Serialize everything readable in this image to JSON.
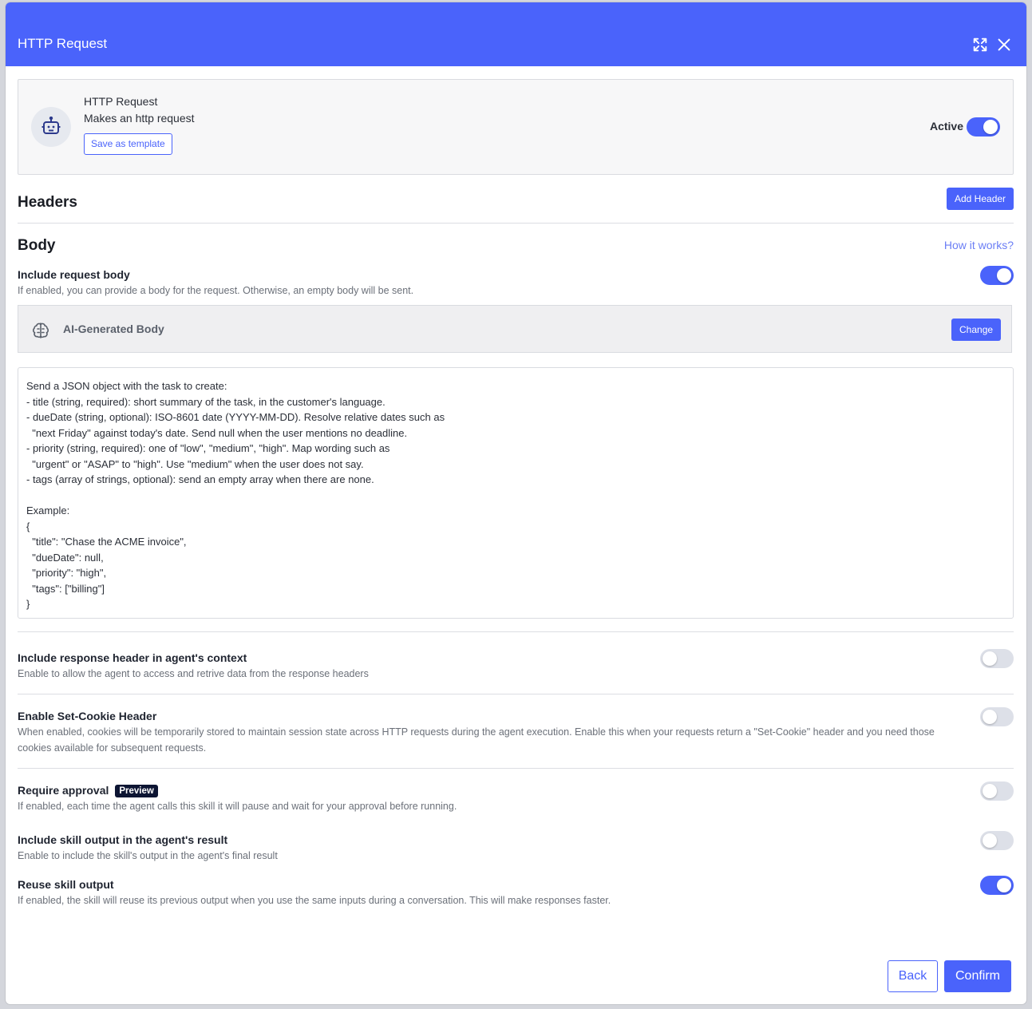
{
  "modal": {
    "title": "HTTP Request",
    "icons": {
      "expand": "expand-icon",
      "close": "close-icon"
    }
  },
  "skill": {
    "name": "HTTP Request",
    "description": "Makes an http request",
    "save_template_label": "Save as template",
    "active_label": "Active",
    "active": true,
    "icon": "robot-icon"
  },
  "headers": {
    "title": "Headers",
    "add_button": "Add Header"
  },
  "body": {
    "title": "Body",
    "how_it_works": "How it works?",
    "include_body": {
      "title": "Include request body",
      "description": "If enabled, you can provide a body for the request. Otherwise, an empty body will be sent.",
      "enabled": true
    },
    "ai_body": {
      "label": "AI-Generated Body",
      "change_button": "Change",
      "icon": "brain-icon"
    },
    "prompt": "Send a JSON object with the task to create:\n- title (string, required): short summary of the task, in the customer's language.\n- dueDate (string, optional): ISO-8601 date (YYYY-MM-DD). Resolve relative dates such as\n  \"next Friday\" against today's date. Send null when the user mentions no deadline.\n- priority (string, required): one of \"low\", \"medium\", \"high\". Map wording such as\n  \"urgent\" or \"ASAP\" to \"high\". Use \"medium\" when the user does not say.\n- tags (array of strings, optional): send an empty array when there are none.\n\nExample:\n{\n  \"title\": \"Chase the ACME invoice\",\n  \"dueDate\": null,\n  \"priority\": \"high\",\n  \"tags\": [\"billing\"]\n}"
  },
  "options": {
    "response_header": {
      "title": "Include response header in agent's context",
      "description": "Enable to allow the agent to access and retrive data from the response headers",
      "enabled": false
    },
    "set_cookie": {
      "title": "Enable Set-Cookie Header",
      "description": "When enabled, cookies will be temporarily stored to maintain session state across HTTP requests during the agent execution. Enable this when your requests return a \"Set-Cookie\" header and you need those cookies available for subsequent requests.",
      "enabled": false
    },
    "require_approval": {
      "title": "Require approval",
      "badge": "Preview",
      "description": "If enabled, each time the agent calls this skill it will pause and wait for your approval before running.",
      "enabled": false
    },
    "include_output": {
      "title": "Include skill output in the agent's result",
      "description": "Enable to include the skill's output in the agent's final result",
      "enabled": false
    },
    "reuse_output": {
      "title": "Reuse skill output",
      "description": "If enabled, the skill will reuse its previous output when you use the same inputs during a conversation. This will make responses faster.",
      "enabled": true
    }
  },
  "footer": {
    "back": "Back",
    "confirm": "Confirm"
  },
  "colors": {
    "accent": "#4a63fb",
    "toggle_off": "#dde0e8",
    "badge_bg": "#0d1533"
  }
}
